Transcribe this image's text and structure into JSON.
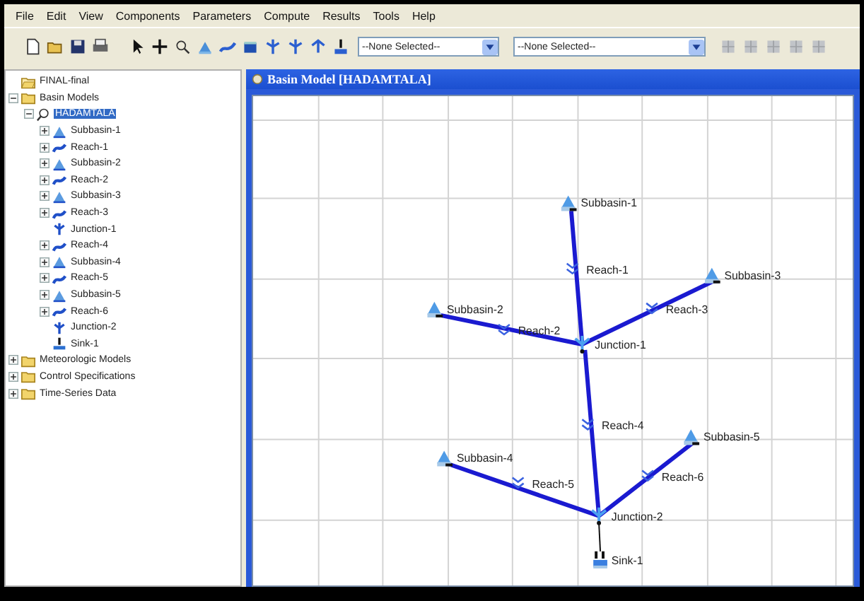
{
  "menu": [
    "File",
    "Edit",
    "View",
    "Components",
    "Parameters",
    "Compute",
    "Results",
    "Tools",
    "Help"
  ],
  "toolbar": {
    "dropdowns": [
      {
        "value": "--None Selected--"
      },
      {
        "value": "--None Selected--"
      }
    ]
  },
  "tree": [
    {
      "label": "FINAL-final",
      "kind": "project",
      "selected": false
    },
    {
      "label": "Basin Models",
      "kind": "folder",
      "expanded": true,
      "selected": false,
      "children": [
        {
          "label": "HADAMTALA",
          "kind": "basin",
          "expanded": true,
          "selected": true,
          "children": [
            {
              "label": "Subbasin-1",
              "kind": "subbasin",
              "expanded": false,
              "selected": false
            },
            {
              "label": "Reach-1",
              "kind": "reach",
              "expanded": false,
              "selected": false
            },
            {
              "label": "Subbasin-2",
              "kind": "subbasin",
              "expanded": false,
              "selected": false
            },
            {
              "label": "Reach-2",
              "kind": "reach",
              "expanded": false,
              "selected": false
            },
            {
              "label": "Subbasin-3",
              "kind": "subbasin",
              "expanded": false,
              "selected": false
            },
            {
              "label": "Reach-3",
              "kind": "reach",
              "expanded": false,
              "selected": false
            },
            {
              "label": "Junction-1",
              "kind": "junction",
              "selected": false
            },
            {
              "label": "Reach-4",
              "kind": "reach",
              "expanded": false,
              "selected": false
            },
            {
              "label": "Subbasin-4",
              "kind": "subbasin",
              "expanded": false,
              "selected": false
            },
            {
              "label": "Reach-5",
              "kind": "reach",
              "expanded": false,
              "selected": false
            },
            {
              "label": "Subbasin-5",
              "kind": "subbasin",
              "expanded": false,
              "selected": false
            },
            {
              "label": "Reach-6",
              "kind": "reach",
              "expanded": false,
              "selected": false
            },
            {
              "label": "Junction-2",
              "kind": "junction",
              "selected": false
            },
            {
              "label": "Sink-1",
              "kind": "sink",
              "selected": false
            }
          ]
        }
      ]
    },
    {
      "label": "Meteorologic Models",
      "kind": "folder",
      "expanded": false,
      "selected": false
    },
    {
      "label": "Control Specifications",
      "kind": "folder",
      "expanded": false,
      "selected": false
    },
    {
      "label": "Time-Series Data",
      "kind": "folder",
      "expanded": false,
      "selected": false
    }
  ],
  "basin_window": {
    "title": "Basin Model [HADAMTALA]"
  },
  "diagram": {
    "nodes": [
      {
        "label": "Subbasin-1",
        "kind": "subbasin"
      },
      {
        "label": "Reach-1",
        "kind": "reach"
      },
      {
        "label": "Subbasin-2",
        "kind": "subbasin"
      },
      {
        "label": "Reach-2",
        "kind": "reach"
      },
      {
        "label": "Subbasin-3",
        "kind": "subbasin"
      },
      {
        "label": "Reach-3",
        "kind": "reach"
      },
      {
        "label": "Junction-1",
        "kind": "junction"
      },
      {
        "label": "Reach-4",
        "kind": "reach"
      },
      {
        "label": "Subbasin-4",
        "kind": "subbasin"
      },
      {
        "label": "Reach-5",
        "kind": "reach"
      },
      {
        "label": "Subbasin-5",
        "kind": "subbasin"
      },
      {
        "label": "Reach-6",
        "kind": "reach"
      },
      {
        "label": "Junction-2",
        "kind": "junction"
      },
      {
        "label": "Sink-1",
        "kind": "sink"
      }
    ]
  }
}
